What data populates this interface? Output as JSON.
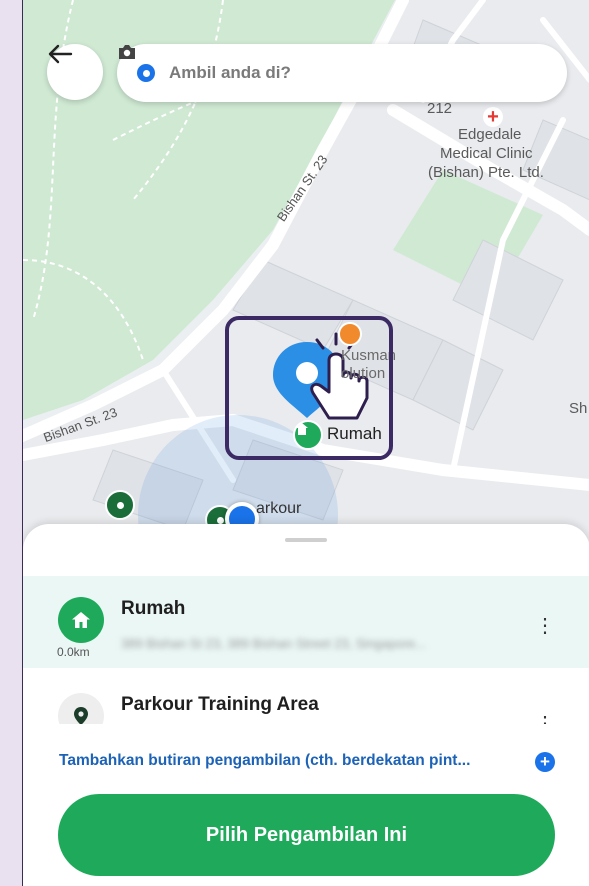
{
  "search": {
    "placeholder": "Ambil anda di?"
  },
  "map": {
    "streets": [
      "Bishan St. 23",
      "Bishan St. 23"
    ],
    "block_number": "212",
    "clinic": [
      "Edgedale",
      "Medical Clinic",
      "(Bishan) Pte. Ltd."
    ],
    "poi_kusman": [
      "Kusman",
      "olution"
    ],
    "poi_sh": "Sh",
    "home_label": "Rumah",
    "parkour_label": "arkour"
  },
  "places": [
    {
      "name": "Rumah",
      "distance": "0.0km",
      "address": "389 Bishan St 23, 389 Bishan Street 23, Singapore...",
      "icon": "home-icon"
    },
    {
      "name": "Parkour Training Area",
      "icon": "location-pin-icon"
    }
  ],
  "add_details": {
    "label": "Tambahkan butiran pengambilan (cth. berdekatan pint..."
  },
  "cta": {
    "label": "Pilih Pengambilan Ini"
  },
  "colors": {
    "brand_green": "#1faa5b",
    "accent_blue": "#1a73e8",
    "park_green": "#cde9d2"
  }
}
